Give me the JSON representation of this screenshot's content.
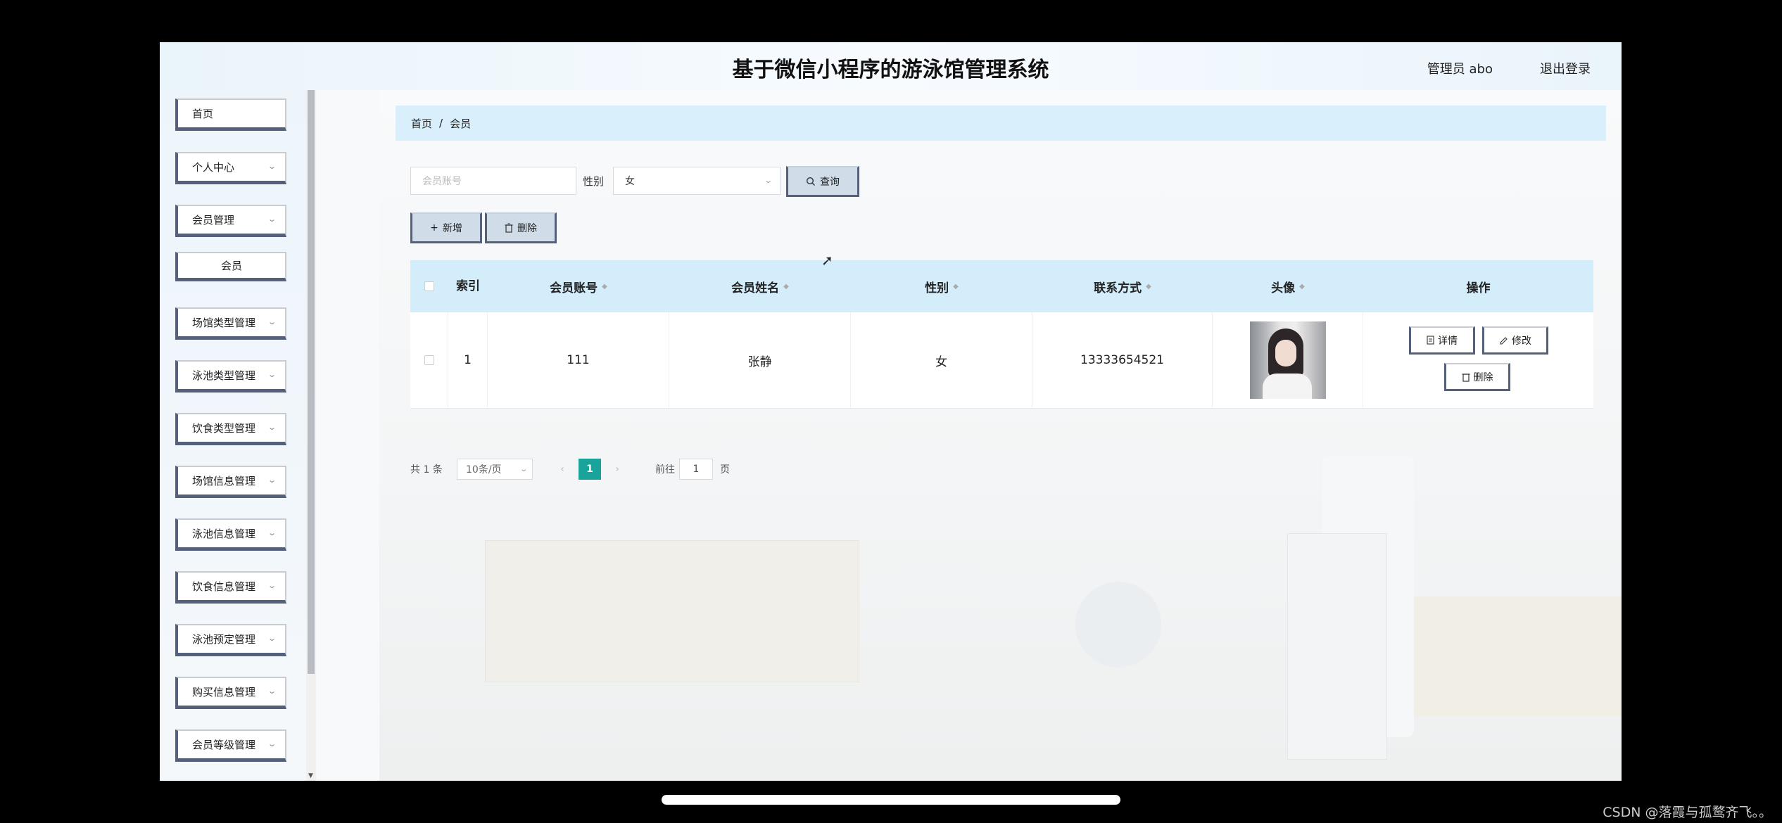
{
  "header": {
    "title": "基于微信小程序的游泳馆管理系统",
    "user": "管理员 abo",
    "logout": "退出登录"
  },
  "sidebar": {
    "items": [
      {
        "label": "首页",
        "has_chevron": false
      },
      {
        "label": "个人中心",
        "has_chevron": true
      },
      {
        "label": "会员管理",
        "has_chevron": true
      },
      {
        "label": "会员",
        "sub": true
      },
      {
        "label": "场馆类型管理",
        "has_chevron": true
      },
      {
        "label": "泳池类型管理",
        "has_chevron": true
      },
      {
        "label": "饮食类型管理",
        "has_chevron": true
      },
      {
        "label": "场馆信息管理",
        "has_chevron": true
      },
      {
        "label": "泳池信息管理",
        "has_chevron": true
      },
      {
        "label": "饮食信息管理",
        "has_chevron": true
      },
      {
        "label": "泳池预定管理",
        "has_chevron": true
      },
      {
        "label": "购买信息管理",
        "has_chevron": true
      },
      {
        "label": "会员等级管理",
        "has_chevron": true
      }
    ]
  },
  "breadcrumb": {
    "home": "首页",
    "separator": "/",
    "current": "会员"
  },
  "search": {
    "account_placeholder": "会员账号",
    "gender_label": "性别",
    "gender_value": "女",
    "query_label": "查询"
  },
  "toolbar": {
    "add_label": "新增",
    "delete_label": "删除"
  },
  "table": {
    "headers": {
      "index": "索引",
      "account": "会员账号",
      "name": "会员姓名",
      "gender": "性别",
      "phone": "联系方式",
      "avatar": "头像",
      "actions": "操作"
    },
    "rows": [
      {
        "index": "1",
        "account": "111",
        "name": "张静",
        "gender": "女",
        "phone": "13333654521",
        "actions": {
          "detail": "详情",
          "edit": "修改",
          "delete": "删除"
        }
      }
    ]
  },
  "pagination": {
    "total": "共 1 条",
    "page_size": "10条/页",
    "current_page": "1",
    "goto_label": "前往",
    "goto_value": "1",
    "page_unit": "页"
  },
  "watermark": "CSDN @落霞与孤鹜齐飞。。",
  "colors": {
    "accent": "#1aa39a",
    "header_bg": "#d4edfa",
    "button_border": "#55607a"
  }
}
